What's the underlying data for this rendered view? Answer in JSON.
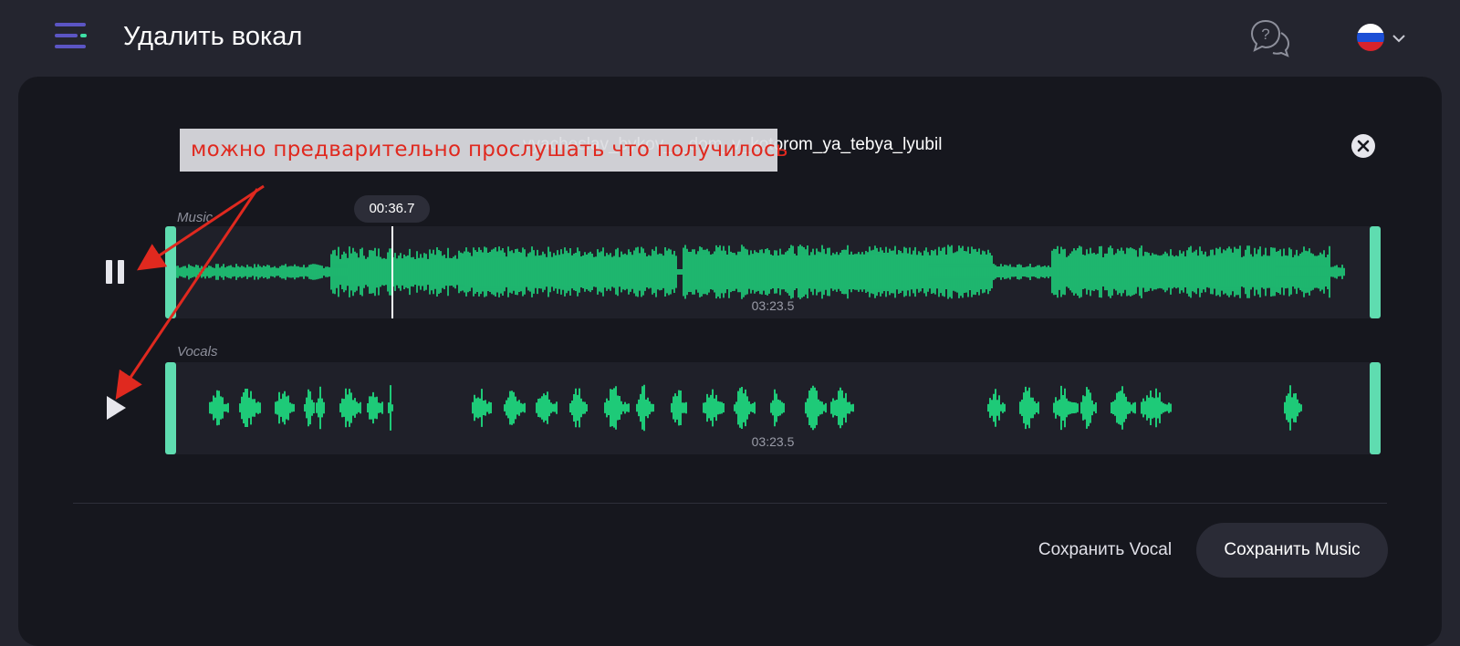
{
  "header": {
    "title": "Удалить вокал",
    "menu_icon": "menu-icon",
    "help_icon": "help-chat-icon",
    "language_icon": "russian-flag-icon"
  },
  "file": {
    "name": "vyacheslav_bykov_-_dom_v_kotorom_ya_tebya_lyubil"
  },
  "tracks": {
    "music": {
      "label": "Music",
      "duration": "03:23.5",
      "state_icon": "pause-icon"
    },
    "vocals": {
      "label": "Vocals",
      "duration": "03:23.5",
      "state_icon": "play-icon"
    },
    "current_time": "00:36.7",
    "progress": 0.18
  },
  "actions": {
    "save_vocal": "Сохранить Vocal",
    "save_music": "Сохранить Music"
  },
  "annotation": {
    "text": "можно предварительно прослушать что получилось"
  },
  "colors": {
    "accent": "#5fdcb0",
    "wave": "#1ef58c",
    "annotation": "#e0291f",
    "background": "#24252f",
    "panel": "#16171e"
  }
}
